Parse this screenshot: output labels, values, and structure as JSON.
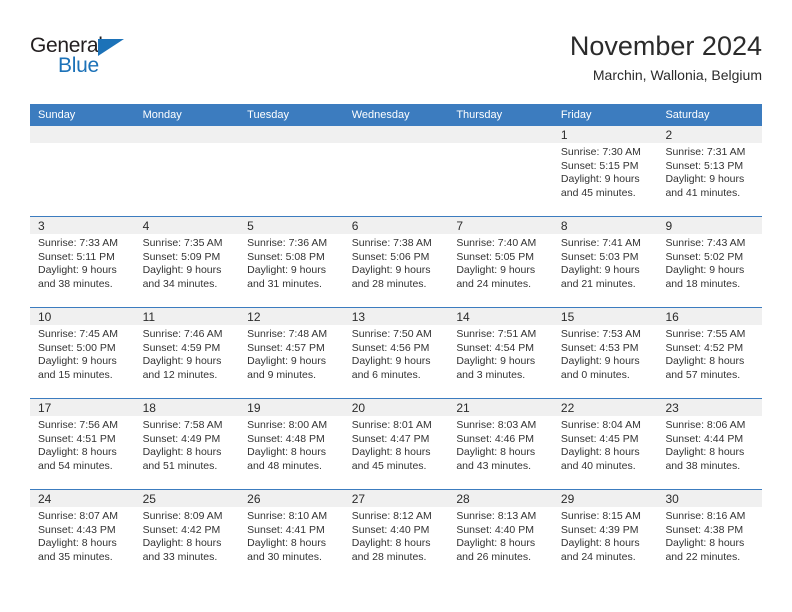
{
  "logo": {
    "word_dark": "General",
    "word_blue": "Blue",
    "triangle_color": "#1c72b8"
  },
  "header": {
    "title": "November 2024",
    "subtitle": "Marchin, Wallonia, Belgium"
  },
  "colors": {
    "header_blue": "#3c7cbf",
    "day_band_gray": "#f0f0f0",
    "text": "#333333"
  },
  "weekdays": [
    "Sunday",
    "Monday",
    "Tuesday",
    "Wednesday",
    "Thursday",
    "Friday",
    "Saturday"
  ],
  "weeks": [
    [
      {
        "day": "",
        "sunrise": "",
        "sunset": "",
        "daylight1": "",
        "daylight2": ""
      },
      {
        "day": "",
        "sunrise": "",
        "sunset": "",
        "daylight1": "",
        "daylight2": ""
      },
      {
        "day": "",
        "sunrise": "",
        "sunset": "",
        "daylight1": "",
        "daylight2": ""
      },
      {
        "day": "",
        "sunrise": "",
        "sunset": "",
        "daylight1": "",
        "daylight2": ""
      },
      {
        "day": "",
        "sunrise": "",
        "sunset": "",
        "daylight1": "",
        "daylight2": ""
      },
      {
        "day": "1",
        "sunrise": "Sunrise: 7:30 AM",
        "sunset": "Sunset: 5:15 PM",
        "daylight1": "Daylight: 9 hours",
        "daylight2": "and 45 minutes."
      },
      {
        "day": "2",
        "sunrise": "Sunrise: 7:31 AM",
        "sunset": "Sunset: 5:13 PM",
        "daylight1": "Daylight: 9 hours",
        "daylight2": "and 41 minutes."
      }
    ],
    [
      {
        "day": "3",
        "sunrise": "Sunrise: 7:33 AM",
        "sunset": "Sunset: 5:11 PM",
        "daylight1": "Daylight: 9 hours",
        "daylight2": "and 38 minutes."
      },
      {
        "day": "4",
        "sunrise": "Sunrise: 7:35 AM",
        "sunset": "Sunset: 5:09 PM",
        "daylight1": "Daylight: 9 hours",
        "daylight2": "and 34 minutes."
      },
      {
        "day": "5",
        "sunrise": "Sunrise: 7:36 AM",
        "sunset": "Sunset: 5:08 PM",
        "daylight1": "Daylight: 9 hours",
        "daylight2": "and 31 minutes."
      },
      {
        "day": "6",
        "sunrise": "Sunrise: 7:38 AM",
        "sunset": "Sunset: 5:06 PM",
        "daylight1": "Daylight: 9 hours",
        "daylight2": "and 28 minutes."
      },
      {
        "day": "7",
        "sunrise": "Sunrise: 7:40 AM",
        "sunset": "Sunset: 5:05 PM",
        "daylight1": "Daylight: 9 hours",
        "daylight2": "and 24 minutes."
      },
      {
        "day": "8",
        "sunrise": "Sunrise: 7:41 AM",
        "sunset": "Sunset: 5:03 PM",
        "daylight1": "Daylight: 9 hours",
        "daylight2": "and 21 minutes."
      },
      {
        "day": "9",
        "sunrise": "Sunrise: 7:43 AM",
        "sunset": "Sunset: 5:02 PM",
        "daylight1": "Daylight: 9 hours",
        "daylight2": "and 18 minutes."
      }
    ],
    [
      {
        "day": "10",
        "sunrise": "Sunrise: 7:45 AM",
        "sunset": "Sunset: 5:00 PM",
        "daylight1": "Daylight: 9 hours",
        "daylight2": "and 15 minutes."
      },
      {
        "day": "11",
        "sunrise": "Sunrise: 7:46 AM",
        "sunset": "Sunset: 4:59 PM",
        "daylight1": "Daylight: 9 hours",
        "daylight2": "and 12 minutes."
      },
      {
        "day": "12",
        "sunrise": "Sunrise: 7:48 AM",
        "sunset": "Sunset: 4:57 PM",
        "daylight1": "Daylight: 9 hours",
        "daylight2": "and 9 minutes."
      },
      {
        "day": "13",
        "sunrise": "Sunrise: 7:50 AM",
        "sunset": "Sunset: 4:56 PM",
        "daylight1": "Daylight: 9 hours",
        "daylight2": "and 6 minutes."
      },
      {
        "day": "14",
        "sunrise": "Sunrise: 7:51 AM",
        "sunset": "Sunset: 4:54 PM",
        "daylight1": "Daylight: 9 hours",
        "daylight2": "and 3 minutes."
      },
      {
        "day": "15",
        "sunrise": "Sunrise: 7:53 AM",
        "sunset": "Sunset: 4:53 PM",
        "daylight1": "Daylight: 9 hours",
        "daylight2": "and 0 minutes."
      },
      {
        "day": "16",
        "sunrise": "Sunrise: 7:55 AM",
        "sunset": "Sunset: 4:52 PM",
        "daylight1": "Daylight: 8 hours",
        "daylight2": "and 57 minutes."
      }
    ],
    [
      {
        "day": "17",
        "sunrise": "Sunrise: 7:56 AM",
        "sunset": "Sunset: 4:51 PM",
        "daylight1": "Daylight: 8 hours",
        "daylight2": "and 54 minutes."
      },
      {
        "day": "18",
        "sunrise": "Sunrise: 7:58 AM",
        "sunset": "Sunset: 4:49 PM",
        "daylight1": "Daylight: 8 hours",
        "daylight2": "and 51 minutes."
      },
      {
        "day": "19",
        "sunrise": "Sunrise: 8:00 AM",
        "sunset": "Sunset: 4:48 PM",
        "daylight1": "Daylight: 8 hours",
        "daylight2": "and 48 minutes."
      },
      {
        "day": "20",
        "sunrise": "Sunrise: 8:01 AM",
        "sunset": "Sunset: 4:47 PM",
        "daylight1": "Daylight: 8 hours",
        "daylight2": "and 45 minutes."
      },
      {
        "day": "21",
        "sunrise": "Sunrise: 8:03 AM",
        "sunset": "Sunset: 4:46 PM",
        "daylight1": "Daylight: 8 hours",
        "daylight2": "and 43 minutes."
      },
      {
        "day": "22",
        "sunrise": "Sunrise: 8:04 AM",
        "sunset": "Sunset: 4:45 PM",
        "daylight1": "Daylight: 8 hours",
        "daylight2": "and 40 minutes."
      },
      {
        "day": "23",
        "sunrise": "Sunrise: 8:06 AM",
        "sunset": "Sunset: 4:44 PM",
        "daylight1": "Daylight: 8 hours",
        "daylight2": "and 38 minutes."
      }
    ],
    [
      {
        "day": "24",
        "sunrise": "Sunrise: 8:07 AM",
        "sunset": "Sunset: 4:43 PM",
        "daylight1": "Daylight: 8 hours",
        "daylight2": "and 35 minutes."
      },
      {
        "day": "25",
        "sunrise": "Sunrise: 8:09 AM",
        "sunset": "Sunset: 4:42 PM",
        "daylight1": "Daylight: 8 hours",
        "daylight2": "and 33 minutes."
      },
      {
        "day": "26",
        "sunrise": "Sunrise: 8:10 AM",
        "sunset": "Sunset: 4:41 PM",
        "daylight1": "Daylight: 8 hours",
        "daylight2": "and 30 minutes."
      },
      {
        "day": "27",
        "sunrise": "Sunrise: 8:12 AM",
        "sunset": "Sunset: 4:40 PM",
        "daylight1": "Daylight: 8 hours",
        "daylight2": "and 28 minutes."
      },
      {
        "day": "28",
        "sunrise": "Sunrise: 8:13 AM",
        "sunset": "Sunset: 4:40 PM",
        "daylight1": "Daylight: 8 hours",
        "daylight2": "and 26 minutes."
      },
      {
        "day": "29",
        "sunrise": "Sunrise: 8:15 AM",
        "sunset": "Sunset: 4:39 PM",
        "daylight1": "Daylight: 8 hours",
        "daylight2": "and 24 minutes."
      },
      {
        "day": "30",
        "sunrise": "Sunrise: 8:16 AM",
        "sunset": "Sunset: 4:38 PM",
        "daylight1": "Daylight: 8 hours",
        "daylight2": "and 22 minutes."
      }
    ]
  ]
}
